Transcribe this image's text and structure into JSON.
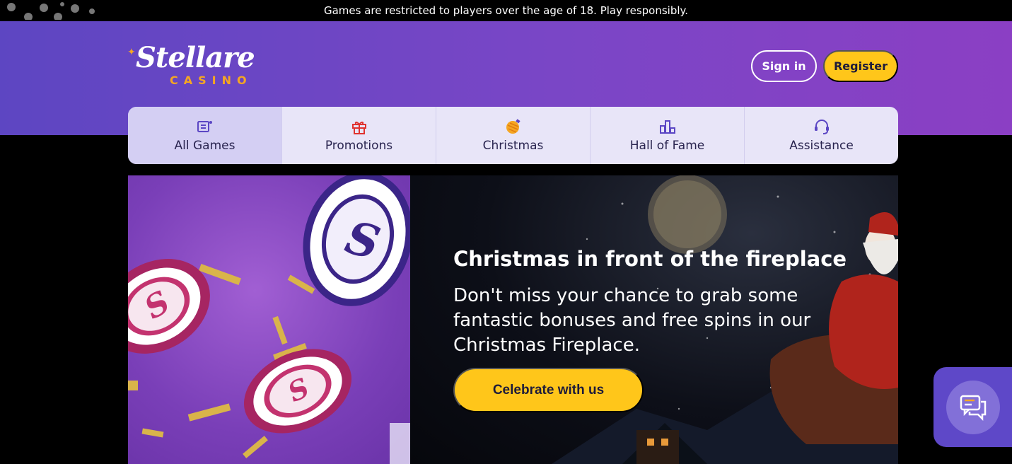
{
  "topbar": {
    "notice": "Games are restricted to players over the age of 18. Play responsibly."
  },
  "brand": {
    "name": "Stellare",
    "sub": "CASINO",
    "accent": "#ffc61a",
    "primary": "#6a46c4"
  },
  "auth": {
    "signin_label": "Sign in",
    "register_label": "Register"
  },
  "nav": {
    "items": [
      {
        "label": "All Games",
        "icon": "games-icon",
        "active": true
      },
      {
        "label": "Promotions",
        "icon": "gift-icon",
        "active": false
      },
      {
        "label": "Christmas",
        "icon": "ornament-icon",
        "active": false
      },
      {
        "label": "Hall of Fame",
        "icon": "podium-icon",
        "active": false
      },
      {
        "label": "Assistance",
        "icon": "headset-icon",
        "active": false
      }
    ]
  },
  "hero": {
    "title": "Christmas in front of the fireplace",
    "text": "Don't miss your chance to grab some fantastic bonuses and free spins in our Christmas Fireplace.",
    "cta_label": "Celebrate with us"
  },
  "chat": {
    "icon": "chat-icon"
  }
}
